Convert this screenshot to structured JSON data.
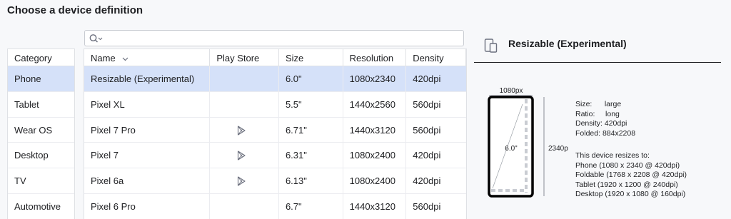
{
  "page": {
    "title": "Choose a device definition"
  },
  "search": {
    "value": "",
    "placeholder": ""
  },
  "categories": {
    "header": "Category",
    "items": [
      {
        "label": "Phone",
        "selected": true
      },
      {
        "label": "Tablet",
        "selected": false
      },
      {
        "label": "Wear OS",
        "selected": false
      },
      {
        "label": "Desktop",
        "selected": false
      },
      {
        "label": "TV",
        "selected": false
      },
      {
        "label": "Automotive",
        "selected": false
      }
    ]
  },
  "devices": {
    "columns": {
      "name": "Name",
      "play_store": "Play Store",
      "size": "Size",
      "resolution": "Resolution",
      "density": "Density"
    },
    "rows": [
      {
        "name": "Resizable (Experimental)",
        "play_store": false,
        "size": "6.0\"",
        "resolution": "1080x2340",
        "density": "420dpi",
        "selected": true
      },
      {
        "name": "Pixel XL",
        "play_store": false,
        "size": "5.5\"",
        "resolution": "1440x2560",
        "density": "560dpi",
        "selected": false
      },
      {
        "name": "Pixel 7 Pro",
        "play_store": true,
        "size": "6.71\"",
        "resolution": "1440x3120",
        "density": "560dpi",
        "selected": false
      },
      {
        "name": "Pixel 7",
        "play_store": true,
        "size": "6.31\"",
        "resolution": "1080x2400",
        "density": "420dpi",
        "selected": false
      },
      {
        "name": "Pixel 6a",
        "play_store": true,
        "size": "6.13\"",
        "resolution": "1080x2400",
        "density": "420dpi",
        "selected": false
      },
      {
        "name": "Pixel 6 Pro",
        "play_store": false,
        "size": "6.7\"",
        "resolution": "1440x3120",
        "density": "560dpi",
        "selected": false
      }
    ]
  },
  "detail": {
    "title": "Resizable (Experimental)",
    "preview": {
      "width_label": "1080px",
      "height_label": "2340px",
      "diagonal_label": "6.0\""
    },
    "specs": {
      "size": "Size:      large",
      "ratio": "Ratio:     long",
      "density": "Density: 420dpi",
      "folded": "Folded: 884x2208"
    },
    "resizes_title": "This device resizes to:",
    "resizes": [
      "Phone (1080 x 2340 @ 420dpi)",
      "Foldable (1768 x 2208 @ 420dpi)",
      "Tablet (1920 x 1200 @ 240dpi)",
      "Desktop (1920 x 1080 @ 160dpi)"
    ]
  },
  "colors": {
    "selection": "#d5e1f9",
    "border": "#dfe1e5",
    "text": "#1e1f22"
  }
}
